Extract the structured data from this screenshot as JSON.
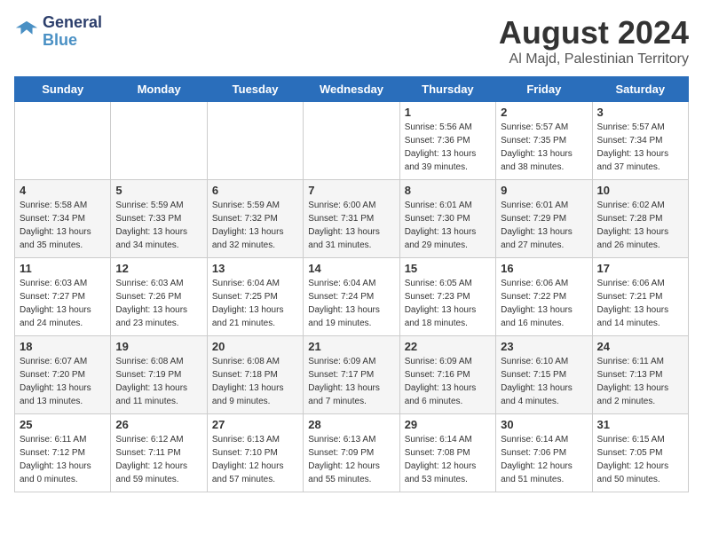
{
  "logo": {
    "line1": "General",
    "line2": "Blue"
  },
  "title": "August 2024",
  "location": "Al Majd, Palestinian Territory",
  "days_of_week": [
    "Sunday",
    "Monday",
    "Tuesday",
    "Wednesday",
    "Thursday",
    "Friday",
    "Saturday"
  ],
  "weeks": [
    [
      {
        "day": "",
        "sunrise": "",
        "sunset": "",
        "daylight": ""
      },
      {
        "day": "",
        "sunrise": "",
        "sunset": "",
        "daylight": ""
      },
      {
        "day": "",
        "sunrise": "",
        "sunset": "",
        "daylight": ""
      },
      {
        "day": "",
        "sunrise": "",
        "sunset": "",
        "daylight": ""
      },
      {
        "day": "1",
        "sunrise": "Sunrise: 5:56 AM",
        "sunset": "Sunset: 7:36 PM",
        "daylight": "Daylight: 13 hours and 39 minutes."
      },
      {
        "day": "2",
        "sunrise": "Sunrise: 5:57 AM",
        "sunset": "Sunset: 7:35 PM",
        "daylight": "Daylight: 13 hours and 38 minutes."
      },
      {
        "day": "3",
        "sunrise": "Sunrise: 5:57 AM",
        "sunset": "Sunset: 7:34 PM",
        "daylight": "Daylight: 13 hours and 37 minutes."
      }
    ],
    [
      {
        "day": "4",
        "sunrise": "Sunrise: 5:58 AM",
        "sunset": "Sunset: 7:34 PM",
        "daylight": "Daylight: 13 hours and 35 minutes."
      },
      {
        "day": "5",
        "sunrise": "Sunrise: 5:59 AM",
        "sunset": "Sunset: 7:33 PM",
        "daylight": "Daylight: 13 hours and 34 minutes."
      },
      {
        "day": "6",
        "sunrise": "Sunrise: 5:59 AM",
        "sunset": "Sunset: 7:32 PM",
        "daylight": "Daylight: 13 hours and 32 minutes."
      },
      {
        "day": "7",
        "sunrise": "Sunrise: 6:00 AM",
        "sunset": "Sunset: 7:31 PM",
        "daylight": "Daylight: 13 hours and 31 minutes."
      },
      {
        "day": "8",
        "sunrise": "Sunrise: 6:01 AM",
        "sunset": "Sunset: 7:30 PM",
        "daylight": "Daylight: 13 hours and 29 minutes."
      },
      {
        "day": "9",
        "sunrise": "Sunrise: 6:01 AM",
        "sunset": "Sunset: 7:29 PM",
        "daylight": "Daylight: 13 hours and 27 minutes."
      },
      {
        "day": "10",
        "sunrise": "Sunrise: 6:02 AM",
        "sunset": "Sunset: 7:28 PM",
        "daylight": "Daylight: 13 hours and 26 minutes."
      }
    ],
    [
      {
        "day": "11",
        "sunrise": "Sunrise: 6:03 AM",
        "sunset": "Sunset: 7:27 PM",
        "daylight": "Daylight: 13 hours and 24 minutes."
      },
      {
        "day": "12",
        "sunrise": "Sunrise: 6:03 AM",
        "sunset": "Sunset: 7:26 PM",
        "daylight": "Daylight: 13 hours and 23 minutes."
      },
      {
        "day": "13",
        "sunrise": "Sunrise: 6:04 AM",
        "sunset": "Sunset: 7:25 PM",
        "daylight": "Daylight: 13 hours and 21 minutes."
      },
      {
        "day": "14",
        "sunrise": "Sunrise: 6:04 AM",
        "sunset": "Sunset: 7:24 PM",
        "daylight": "Daylight: 13 hours and 19 minutes."
      },
      {
        "day": "15",
        "sunrise": "Sunrise: 6:05 AM",
        "sunset": "Sunset: 7:23 PM",
        "daylight": "Daylight: 13 hours and 18 minutes."
      },
      {
        "day": "16",
        "sunrise": "Sunrise: 6:06 AM",
        "sunset": "Sunset: 7:22 PM",
        "daylight": "Daylight: 13 hours and 16 minutes."
      },
      {
        "day": "17",
        "sunrise": "Sunrise: 6:06 AM",
        "sunset": "Sunset: 7:21 PM",
        "daylight": "Daylight: 13 hours and 14 minutes."
      }
    ],
    [
      {
        "day": "18",
        "sunrise": "Sunrise: 6:07 AM",
        "sunset": "Sunset: 7:20 PM",
        "daylight": "Daylight: 13 hours and 13 minutes."
      },
      {
        "day": "19",
        "sunrise": "Sunrise: 6:08 AM",
        "sunset": "Sunset: 7:19 PM",
        "daylight": "Daylight: 13 hours and 11 minutes."
      },
      {
        "day": "20",
        "sunrise": "Sunrise: 6:08 AM",
        "sunset": "Sunset: 7:18 PM",
        "daylight": "Daylight: 13 hours and 9 minutes."
      },
      {
        "day": "21",
        "sunrise": "Sunrise: 6:09 AM",
        "sunset": "Sunset: 7:17 PM",
        "daylight": "Daylight: 13 hours and 7 minutes."
      },
      {
        "day": "22",
        "sunrise": "Sunrise: 6:09 AM",
        "sunset": "Sunset: 7:16 PM",
        "daylight": "Daylight: 13 hours and 6 minutes."
      },
      {
        "day": "23",
        "sunrise": "Sunrise: 6:10 AM",
        "sunset": "Sunset: 7:15 PM",
        "daylight": "Daylight: 13 hours and 4 minutes."
      },
      {
        "day": "24",
        "sunrise": "Sunrise: 6:11 AM",
        "sunset": "Sunset: 7:13 PM",
        "daylight": "Daylight: 13 hours and 2 minutes."
      }
    ],
    [
      {
        "day": "25",
        "sunrise": "Sunrise: 6:11 AM",
        "sunset": "Sunset: 7:12 PM",
        "daylight": "Daylight: 13 hours and 0 minutes."
      },
      {
        "day": "26",
        "sunrise": "Sunrise: 6:12 AM",
        "sunset": "Sunset: 7:11 PM",
        "daylight": "Daylight: 12 hours and 59 minutes."
      },
      {
        "day": "27",
        "sunrise": "Sunrise: 6:13 AM",
        "sunset": "Sunset: 7:10 PM",
        "daylight": "Daylight: 12 hours and 57 minutes."
      },
      {
        "day": "28",
        "sunrise": "Sunrise: 6:13 AM",
        "sunset": "Sunset: 7:09 PM",
        "daylight": "Daylight: 12 hours and 55 minutes."
      },
      {
        "day": "29",
        "sunrise": "Sunrise: 6:14 AM",
        "sunset": "Sunset: 7:08 PM",
        "daylight": "Daylight: 12 hours and 53 minutes."
      },
      {
        "day": "30",
        "sunrise": "Sunrise: 6:14 AM",
        "sunset": "Sunset: 7:06 PM",
        "daylight": "Daylight: 12 hours and 51 minutes."
      },
      {
        "day": "31",
        "sunrise": "Sunrise: 6:15 AM",
        "sunset": "Sunset: 7:05 PM",
        "daylight": "Daylight: 12 hours and 50 minutes."
      }
    ]
  ]
}
